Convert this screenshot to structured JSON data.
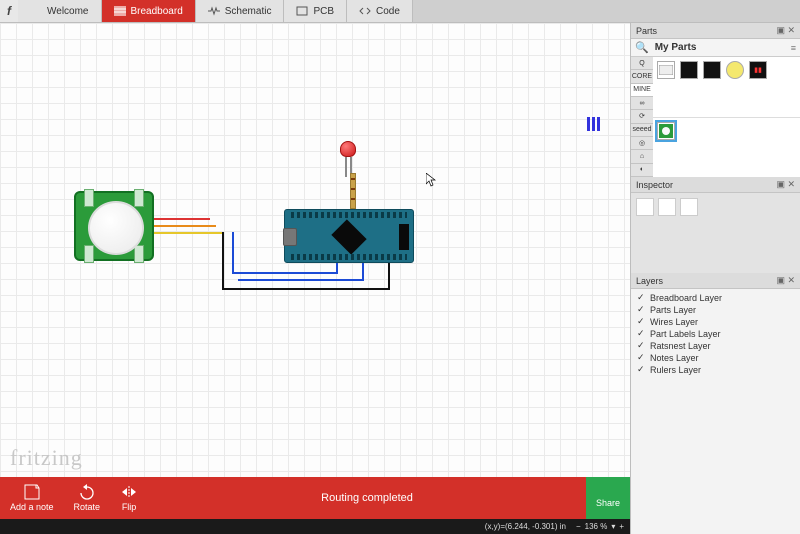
{
  "app": {
    "logo_glyph": "f",
    "watermark": "fritzing"
  },
  "tabs": [
    {
      "id": "welcome",
      "label": "Welcome"
    },
    {
      "id": "breadboard",
      "label": "Breadboard",
      "active": true
    },
    {
      "id": "schematic",
      "label": "Schematic"
    },
    {
      "id": "pcb",
      "label": "PCB"
    },
    {
      "id": "code",
      "label": "Code"
    }
  ],
  "side_panels": {
    "parts": {
      "title": "Parts",
      "bin_title": "My Parts",
      "vtabs": [
        "Q",
        "CORE",
        "MINE",
        "∞",
        "⟳",
        "seeed",
        "◎",
        "⌂",
        "◐"
      ],
      "selected_vtab": 2,
      "core_items": [
        "breadboard-part",
        "ic-part",
        "ic-part-2",
        "led-part",
        "display-part"
      ],
      "mine_items": [
        "pir-part"
      ]
    },
    "inspector": {
      "title": "Inspector"
    },
    "layers": {
      "title": "Layers",
      "items": [
        "Breadboard Layer",
        "Parts Layer",
        "Wires Layer",
        "Part Labels Layer",
        "Ratsnest Layer",
        "Notes Layer",
        "Rulers Layer"
      ]
    }
  },
  "bottom": {
    "buttons": {
      "note": "Add a note",
      "rotate": "Rotate",
      "flip": "Flip"
    },
    "status_msg": "Routing completed",
    "share": "Share"
  },
  "statusbar": {
    "coords": "(x,y)=(6.244, -0.301) in",
    "zoom": "136 %"
  },
  "canvas": {
    "components": [
      {
        "name": "pir-motion-sensor"
      },
      {
        "name": "arduino-nano"
      },
      {
        "name": "red-led"
      },
      {
        "name": "resistor"
      }
    ]
  }
}
